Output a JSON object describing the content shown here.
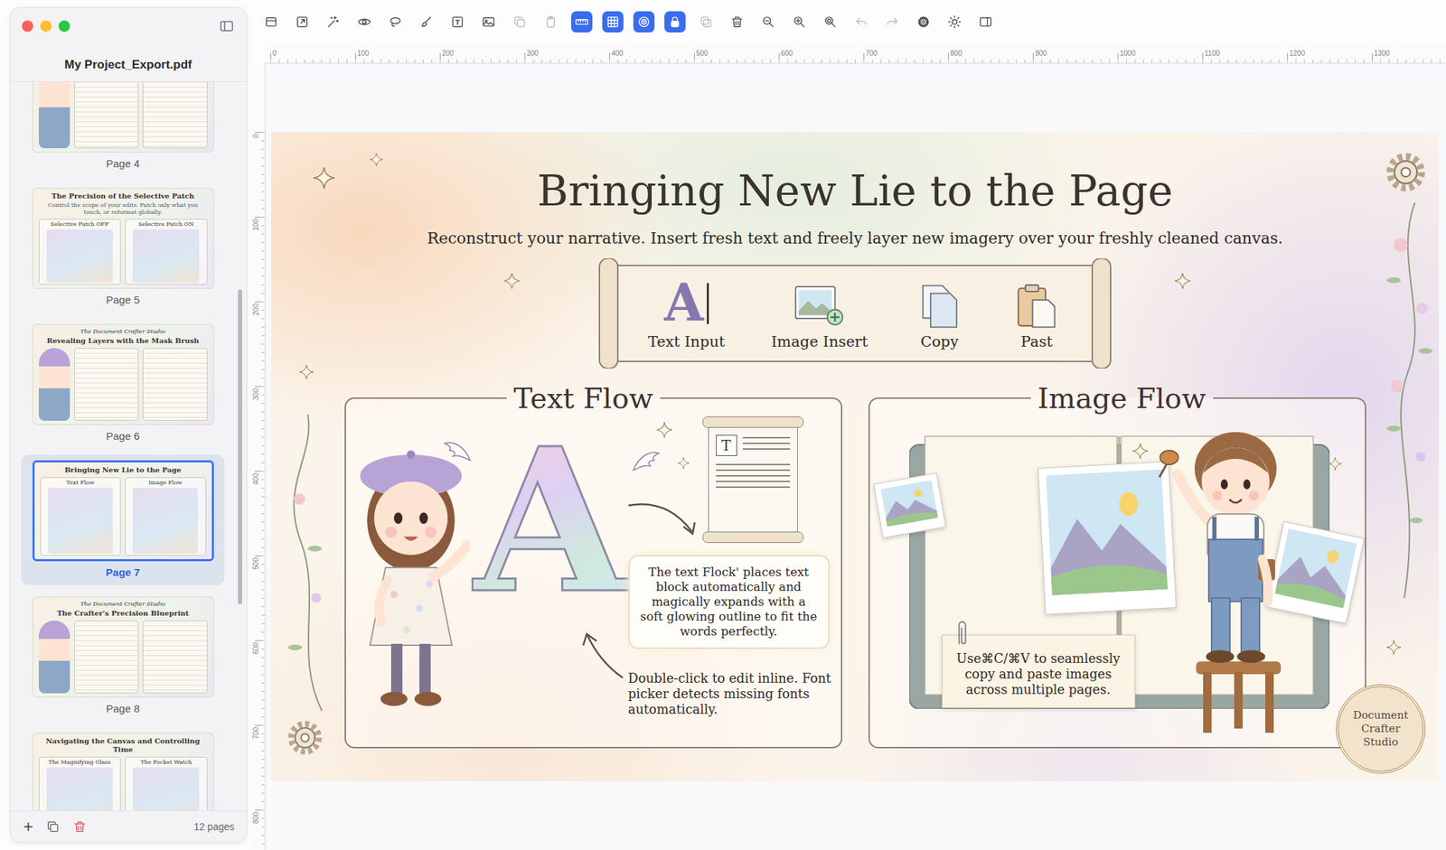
{
  "window": {
    "title": "My Project_Export.pdf",
    "controls": [
      {
        "color": "#ff5f57"
      },
      {
        "color": "#febc2e"
      },
      {
        "color": "#28c840"
      }
    ]
  },
  "toolbar": [
    {
      "kind": "pages",
      "active": false,
      "disabled": false
    },
    {
      "kind": "export",
      "active": false,
      "disabled": false
    },
    {
      "kind": "wand",
      "active": false,
      "disabled": false
    },
    {
      "kind": "eye",
      "active": false,
      "disabled": false
    },
    {
      "kind": "lasso",
      "active": false,
      "disabled": false
    },
    {
      "kind": "brush",
      "active": false,
      "disabled": false
    },
    {
      "kind": "text",
      "glyph": "T",
      "active": false,
      "disabled": false
    },
    {
      "kind": "image",
      "active": false,
      "disabled": false
    },
    {
      "kind": "copy",
      "active": false,
      "disabled": true
    },
    {
      "kind": "paste",
      "active": false,
      "disabled": true
    },
    {
      "kind": "ruler",
      "active": true,
      "disabled": false
    },
    {
      "kind": "grid",
      "active": true,
      "disabled": false
    },
    {
      "kind": "target",
      "active": true,
      "disabled": false
    },
    {
      "kind": "lock",
      "active": true,
      "disabled": false
    },
    {
      "kind": "duplicate",
      "active": false,
      "disabled": true
    },
    {
      "kind": "trash",
      "active": false,
      "disabled": false
    },
    {
      "kind": "zoom-out",
      "active": false,
      "disabled": false
    },
    {
      "kind": "zoom-in",
      "active": false,
      "disabled": false
    },
    {
      "kind": "zoom-fit",
      "active": false,
      "disabled": false
    },
    {
      "kind": "undo",
      "active": false,
      "disabled": true
    },
    {
      "kind": "redo",
      "active": false,
      "disabled": true
    },
    {
      "kind": "gear",
      "active": false,
      "disabled": false
    },
    {
      "kind": "sun",
      "active": false,
      "disabled": false
    },
    {
      "kind": "panel-right",
      "active": false,
      "disabled": false
    }
  ],
  "sidebar": {
    "pages": [
      {
        "label": "Page 4",
        "selected": false,
        "thumb": {}
      },
      {
        "label": "Page 5",
        "selected": false,
        "thumb": {
          "title": "The Precision of the Selective Patch",
          "caption": "Control the scope of your edits. Patch only what you touch, or reformat globally.",
          "panels": [
            "Selective Patch OFF",
            "Selective Patch ON"
          ]
        }
      },
      {
        "label": "Page 6",
        "selected": false,
        "thumb": {
          "eyebrow": "The Document Crafter Studio",
          "title": "Revealing Layers with the Mask Brush"
        }
      },
      {
        "label": "Page 7",
        "selected": true,
        "thumb": {
          "title": "Bringing New Lie to the Page",
          "panels": [
            "Text Flow",
            "Image Flow"
          ]
        }
      },
      {
        "label": "Page 8",
        "selected": false,
        "thumb": {
          "eyebrow": "The Document Crafter Studio",
          "title": "The Crafter's Precision Blueprint"
        }
      },
      {
        "selected": false,
        "thumb": {
          "title": "Navigating the Canvas and Controlling Time",
          "panels": [
            "The Magnifying Glass",
            "The Pocket Watch"
          ]
        }
      }
    ],
    "footer": {
      "add": "+",
      "count": "12 pages"
    }
  },
  "rulers": {
    "horizontal": [
      "0",
      "100",
      "200",
      "300",
      "400",
      "500",
      "600",
      "700",
      "800",
      "900",
      "1000",
      "1100",
      "1200",
      "1300"
    ],
    "vertical": [
      "0",
      "100",
      "200",
      "300",
      "400",
      "500",
      "600",
      "700",
      "800"
    ]
  },
  "document": {
    "title": "Bringing New Lie to the Page",
    "subtitle": "Reconstruct your narrative. Insert fresh text and freely layer new imagery over your freshly cleaned canvas.",
    "tools": [
      {
        "kind": "text",
        "label": "Text Input",
        "glyph": "A"
      },
      {
        "kind": "image",
        "label": "Image Insert"
      },
      {
        "kind": "copy",
        "label": "Copy"
      },
      {
        "kind": "paste",
        "label": "Past"
      }
    ],
    "text_panel": {
      "title": "Text Flow",
      "glyph": "A",
      "doc_glyph": "T",
      "callout": "The text Flock' places text block automatically and magically expands with a soft glowing outline to fit the words perfectly.",
      "note": "Double-click to edit inline. Font picker detects missing fonts automatically."
    },
    "image_panel": {
      "title": "Image Flow",
      "note": "Use⌘C/⌘V to seamlessly copy and paste images across multiple pages."
    },
    "seal": "Document Crafter Studio"
  }
}
